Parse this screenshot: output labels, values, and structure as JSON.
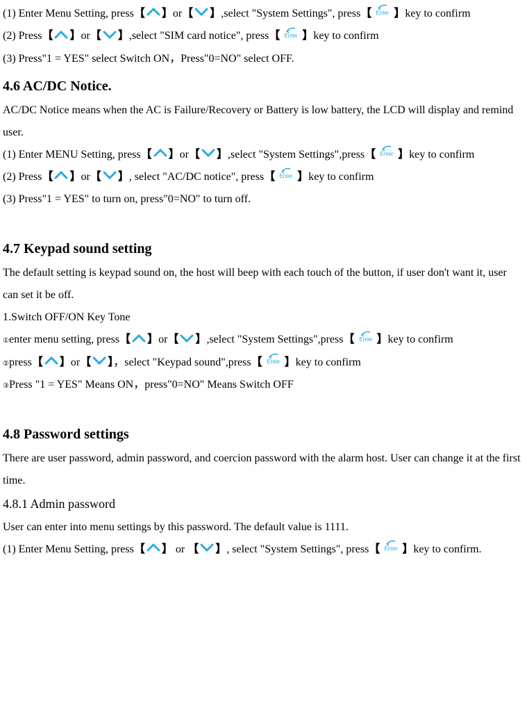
{
  "sec45": {
    "step1_a": "(1) Enter Menu Setting, press",
    "step1_b": "or",
    "step1_c": ",select \"System Settings\", press",
    "step1_d": "key to confirm",
    "step2_a": "(2) Press",
    "step2_b": "or",
    "step2_c": ",select \"SIM card notice\", press",
    "step2_d": "key to confirm",
    "step3": "(3) Press\"1 = YES\" select Switch ON，Press\"0=NO\" select OFF."
  },
  "sec46": {
    "title": "4.6 AC/DC Notice.",
    "intro": "AC/DC Notice means when the AC is Failure/Recovery or Battery is low battery, the LCD will display and remind user.",
    "step1_a": "(1) Enter MENU Setting, press",
    "step1_b": "or",
    "step1_c": ",select \"System Settings\",press",
    "step1_d": "key to confirm",
    "step2_a": "(2) Press",
    "step2_b": "or",
    "step2_c": ", select \"AC/DC notice\", press",
    "step2_d": "key to confirm",
    "step3": "(3) Press\"1 = YES\" to turn on, press\"0=NO\" to turn off."
  },
  "sec47": {
    "title": "4.7 Keypad sound setting",
    "intro": "The default setting is keypad sound on, the host will beep with each touch of the button, if user don't want it, user can set it be off.",
    "sub1": "1.Switch OFF/ON Key Tone",
    "step1_a": "enter menu setting, press",
    "step1_b": "or",
    "step1_c": ",select \"System Settings\",press",
    "step1_d": "key to confirm",
    "step2_a": "press",
    "step2_b": "or",
    "step2_c": "，select \"Keypad sound\",press",
    "step2_d": "key to confirm",
    "step3": "Press \"1 = YES\" Means ON，press\"0=NO\" Means Switch OFF"
  },
  "sec48": {
    "title": "4.8 Password settings",
    "intro": "There are user password, admin password, and coercion password with the alarm host. User can change it at the first time.",
    "sub481": "4.8.1 Admin password",
    "sub481_intro": "User can enter into menu settings by this password. The default value is 1111.",
    "step1_a": "(1) Enter Menu Setting, press",
    "step1_b": " or ",
    "step1_c": ", select \"System Settings\", press",
    "step1_d": "key to confirm."
  },
  "circled": {
    "c1": "①",
    "c2": "②",
    "c3": "③"
  },
  "brackets": {
    "open": "【",
    "close": "】"
  }
}
